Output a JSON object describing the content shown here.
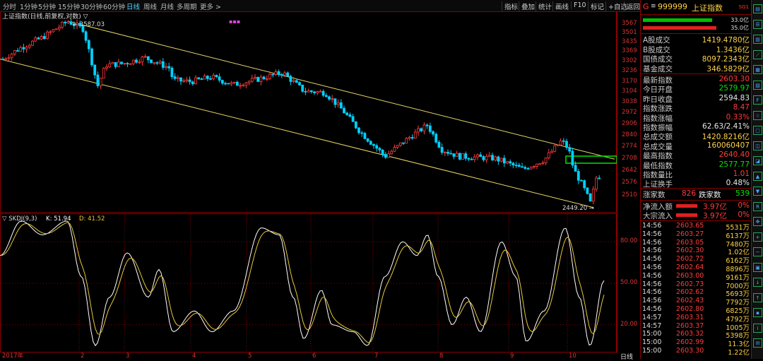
{
  "toolbar": {
    "timeframes": [
      "分时",
      "1分钟",
      "5分钟",
      "15分钟",
      "30分钟",
      "60分钟",
      "日线",
      "周线",
      "月线",
      "多周期",
      "更多 >"
    ],
    "active_timeframe": "日线",
    "buttons": [
      "指标",
      "叠加",
      "统计",
      "画线",
      "F10",
      "标记",
      "+自选",
      "返回"
    ]
  },
  "chart": {
    "title": "上证指数(日线,前复权,对数)",
    "high_label": "3587.03",
    "low_label": "2449.20",
    "kdj_label": "SKDJ(9,3)",
    "kdj_k": "K: 51.94",
    "kdj_d": "D: 41.52",
    "price_axis": [
      "3567",
      "3501",
      "3435",
      "3369",
      "3302",
      "3236",
      "3170",
      "3104",
      "3038",
      "2972",
      "2906",
      "2840",
      "2774",
      "2708",
      "2642",
      "2576",
      "2510"
    ],
    "kdj_axis": [
      "80.00",
      "50.00",
      "20.00"
    ],
    "months": [
      "2017年",
      "2",
      "3",
      "4",
      "5",
      "6",
      "7",
      "8",
      "9",
      "10"
    ],
    "period_label": "日线",
    "colors": {
      "up": "#ff3b3b",
      "down": "#00d0ff",
      "channel": "#e8d66a",
      "k": "#ffffff",
      "d": "#e8c83a"
    }
  },
  "panel": {
    "header_code": "999999",
    "header_name": "上证指数",
    "header_prefix": "G",
    "header_tag": "SG1",
    "bar1_label": "33.0亿",
    "bar2_label": "35.0亿",
    "turnover": [
      {
        "k": "A股成交",
        "v": "1419.4780亿"
      },
      {
        "k": "B股成交",
        "v": "1.3436亿"
      },
      {
        "k": "国债成交",
        "v": "8097.2343亿"
      },
      {
        "k": "基金成交",
        "v": "346.5829亿"
      }
    ],
    "quote": [
      {
        "k": "最新指数",
        "v": "2603.30",
        "c": "red"
      },
      {
        "k": "今日开盘",
        "v": "2579.97",
        "c": "grn"
      },
      {
        "k": "昨日收盘",
        "v": "2594.83",
        "c": "wht"
      },
      {
        "k": "指数涨跌",
        "v": "8.47",
        "c": "red"
      },
      {
        "k": "指数涨幅",
        "v": "0.33%",
        "c": "red"
      },
      {
        "k": "指数振幅",
        "v": "62.63/2.41%",
        "c": "wht"
      },
      {
        "k": "总成交额",
        "v": "1420.8216亿",
        "c": "yel"
      },
      {
        "k": "总成交量",
        "v": "160060407",
        "c": "yel"
      },
      {
        "k": "最高指数",
        "v": "2640.40",
        "c": "red"
      },
      {
        "k": "最低指数",
        "v": "2577.77",
        "c": "grn"
      },
      {
        "k": "指数量比",
        "v": "1.01",
        "c": "red"
      },
      {
        "k": "上证换手",
        "v": "0.48%",
        "c": "wht"
      }
    ],
    "breadth": {
      "up_label": "涨家数",
      "up": "826",
      "down_label": "跌家数",
      "down": "539"
    },
    "flows": [
      {
        "k": "净流入额",
        "v": "3.97亿",
        "pct": "0%"
      },
      {
        "k": "大宗流入",
        "v": "3.97亿",
        "pct": "0%"
      }
    ],
    "ticks": [
      {
        "t": "14:56",
        "p": "2603.65",
        "q": "5531万"
      },
      {
        "t": "14:56",
        "p": "2603.27",
        "q": "6137万"
      },
      {
        "t": "14:56",
        "p": "2603.05",
        "q": "7480万"
      },
      {
        "t": "14:56",
        "p": "2602.30",
        "q": "1.02亿"
      },
      {
        "t": "14:56",
        "p": "2602.72",
        "q": "6162万"
      },
      {
        "t": "14:56",
        "p": "2602.64",
        "q": "8896万"
      },
      {
        "t": "14:56",
        "p": "2603.00",
        "q": "9161万"
      },
      {
        "t": "14:56",
        "p": "2602.73",
        "q": "7000万"
      },
      {
        "t": "14:56",
        "p": "2602.62",
        "q": "5693万"
      },
      {
        "t": "14:56",
        "p": "2602.43",
        "q": "7792万"
      },
      {
        "t": "14:56",
        "p": "2602.80",
        "q": "6825万"
      },
      {
        "t": "14:57",
        "p": "2603.31",
        "q": "4792万"
      },
      {
        "t": "14:57",
        "p": "2603.37",
        "q": "1005万"
      },
      {
        "t": "15:00",
        "p": "2603.32",
        "q": "5398万"
      },
      {
        "t": "15:00",
        "p": "2602.99",
        "q": "11.3亿"
      },
      {
        "t": "15:00",
        "p": "2603.30",
        "q": "1.22亿"
      }
    ]
  },
  "tools": [
    "chart-icon",
    "list-icon",
    "bars-icon",
    "trend-icon",
    "grid-icon",
    "table-icon",
    "f10-icon",
    "star-icon",
    "box-icon",
    "news-icon",
    "tag-icon",
    "up-icon",
    "down-icon",
    "rsi-icon",
    "cross-icon",
    "zoom-in-icon",
    "zoom-out-icon",
    "screen-icon",
    "down2-icon",
    "up2-icon",
    "save-icon",
    "info-icon",
    "mail-icon"
  ]
}
